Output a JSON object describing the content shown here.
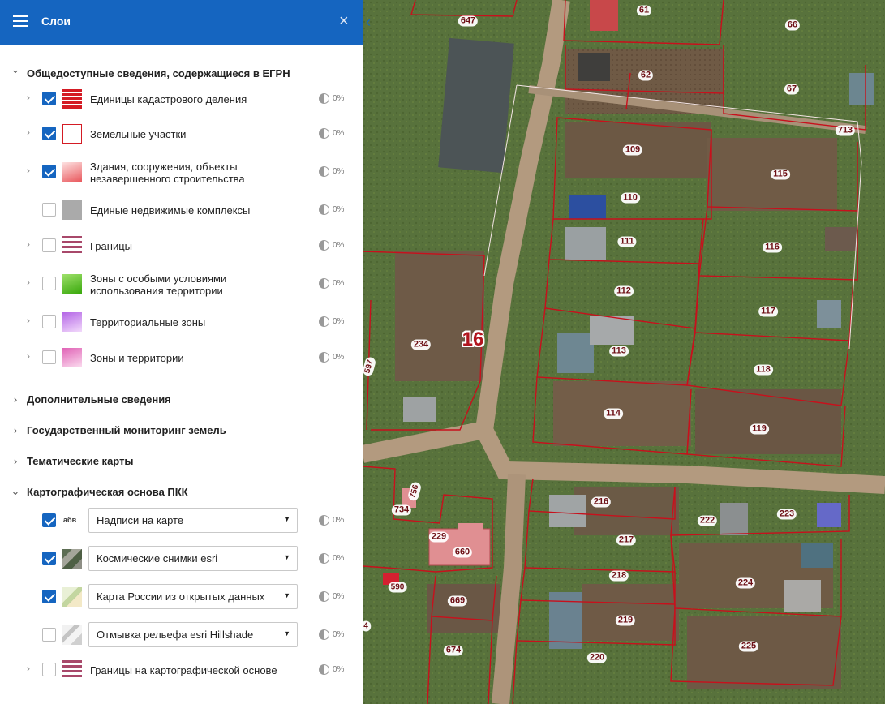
{
  "panel": {
    "title": "Слои",
    "close_icon": "×",
    "collapse_icon": "‹"
  },
  "groups": {
    "egrn": {
      "label": "Общедоступные сведения, содержащиеся в ЕГРН",
      "chevron": "⌄"
    },
    "extra": {
      "label": "Дополнительные сведения",
      "chevron": "›"
    },
    "monitoring": {
      "label": "Государственный мониторинг земель",
      "chevron": "›"
    },
    "thematic": {
      "label": "Тематические карты",
      "chevron": "›"
    },
    "basemap": {
      "label": "Картографическая основа ПКК",
      "chevron": "⌄"
    }
  },
  "egrn_layers": [
    {
      "label": "Единицы кадастрового деления",
      "checked": true,
      "opacity": "0%",
      "legend": "red-stripes-icon"
    },
    {
      "label": "Земельные участки",
      "checked": true,
      "opacity": "0%",
      "legend": "red-outline-square-icon"
    },
    {
      "label": "Здания, сооружения, объекты незавершенного строительства",
      "checked": true,
      "opacity": "0%",
      "legend": "pink-gradient-icon"
    },
    {
      "label": "Единые недвижимые комплексы",
      "checked": false,
      "opacity": "0%",
      "legend": "gray-square-icon"
    },
    {
      "label": "Границы",
      "checked": false,
      "opacity": "0%",
      "legend": "purple-stripes-icon"
    },
    {
      "label": "Зоны с особыми условиями использования территории",
      "checked": false,
      "opacity": "0%",
      "legend": "green-gradient-icon"
    },
    {
      "label": "Территориальные зоны",
      "checked": false,
      "opacity": "0%",
      "legend": "violet-gradient-icon"
    },
    {
      "label": "Зоны и территории",
      "checked": false,
      "opacity": "0%",
      "legend": "magenta-gradient-icon"
    }
  ],
  "basemap_layers": [
    {
      "select_value": "Надписи на карте",
      "checked": true,
      "opacity": "0%",
      "legend_text": "абв"
    },
    {
      "select_value": "Космические снимки esri",
      "checked": true,
      "opacity": "0%",
      "legend": "satellite-thumb-icon"
    },
    {
      "select_value": "Карта России из открытых данных",
      "checked": true,
      "opacity": "0%",
      "legend": "map-thumb-icon"
    },
    {
      "select_value": "Отмывка рельефа esri Hillshade",
      "checked": false,
      "opacity": "0%",
      "legend": "hillshade-thumb-icon"
    },
    {
      "label": "Границы на картографической основе",
      "checked": false,
      "opacity": "0%",
      "legend": "purple-stripes-icon"
    }
  ],
  "map": {
    "quarter_label": "16",
    "plot_numbers": [
      "647",
      "61",
      "66",
      "62",
      "67",
      "713",
      "109",
      "115",
      "110",
      "111",
      "116",
      "112",
      "117",
      "113",
      "118",
      "234",
      "597",
      "114",
      "119",
      "216",
      "222",
      "223",
      "217",
      "734",
      "756",
      "229",
      "660",
      "218",
      "224",
      "590",
      "669",
      "219",
      "674",
      "225",
      "220",
      "4"
    ]
  }
}
